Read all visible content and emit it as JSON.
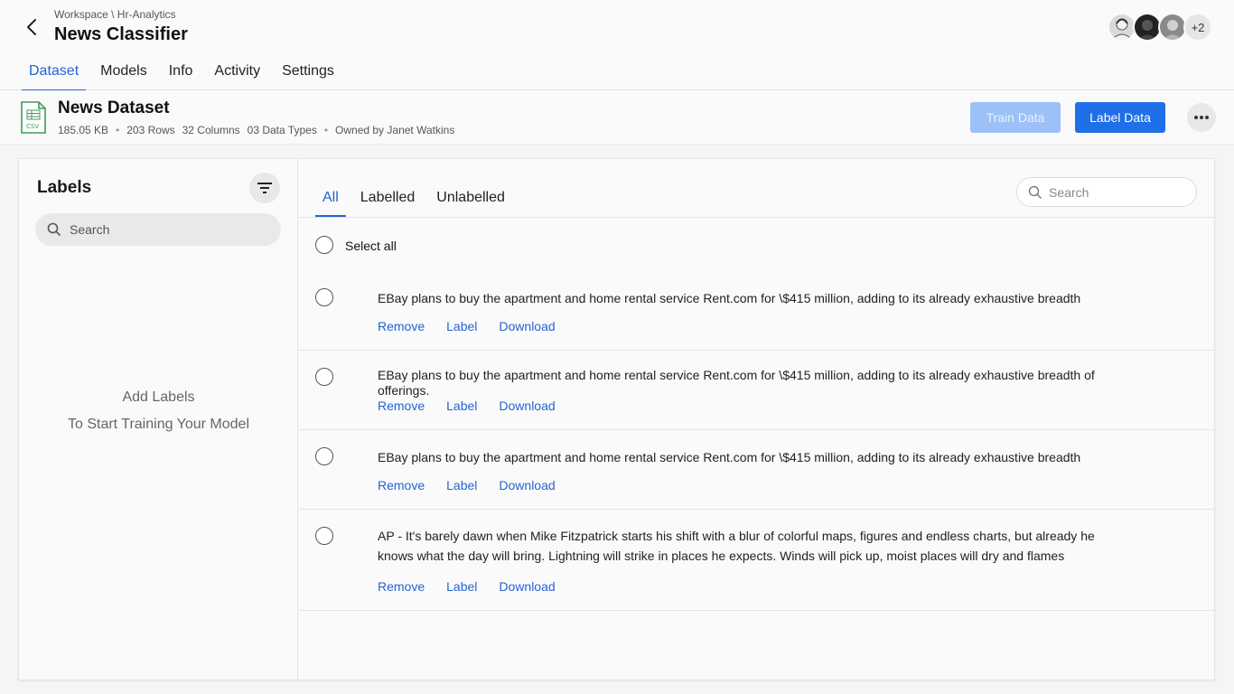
{
  "header": {
    "breadcrumb": "Workspace \\ Hr-Analytics",
    "title": "News Classifier",
    "avatars_more": "+2"
  },
  "tabs": [
    {
      "label": "Dataset",
      "active": true
    },
    {
      "label": "Models"
    },
    {
      "label": "Info"
    },
    {
      "label": "Activity"
    },
    {
      "label": "Settings"
    }
  ],
  "dataset": {
    "title": "News Dataset",
    "size": "185.05 KB",
    "rows": "203 Rows",
    "columns": "32 Columns",
    "types": "03 Data Types",
    "owner": "Owned by Janet Watkins",
    "train_label": "Train Data",
    "label_label": "Label Data"
  },
  "labels_panel": {
    "title": "Labels",
    "search_placeholder": "Search",
    "empty_line1": "Add Labels",
    "empty_line2": "To Start Training Your Model"
  },
  "data_panel": {
    "tabs": [
      {
        "label": "All",
        "active": true
      },
      {
        "label": "Labelled"
      },
      {
        "label": "Unlabelled"
      }
    ],
    "search_placeholder": "Search",
    "select_all": "Select all",
    "rows": [
      {
        "text": "EBay plans to buy the apartment and home rental service Rent.com for \\$415 million, adding to its already exhaustive breadth"
      },
      {
        "text": "EBay plans to buy the apartment and home rental service Rent.com for \\$415 million, adding to its already exhaustive breadth of offerings."
      },
      {
        "text": "EBay plans to buy the apartment and home rental service Rent.com for \\$415 million, adding to its already exhaustive breadth"
      },
      {
        "text": "AP - It's barely dawn when Mike Fitzpatrick starts his shift with a blur of colorful maps, figures and endless charts, but already he knows what the day will bring. Lightning will strike in places he expects. Winds will pick up, moist places will dry and flames"
      }
    ],
    "actions": {
      "remove": "Remove",
      "label": "Label",
      "download": "Download"
    }
  },
  "colors": {
    "accent": "#2463d4",
    "primary_button": "#1f6fe8",
    "disabled_button": "#9cc1f7"
  }
}
